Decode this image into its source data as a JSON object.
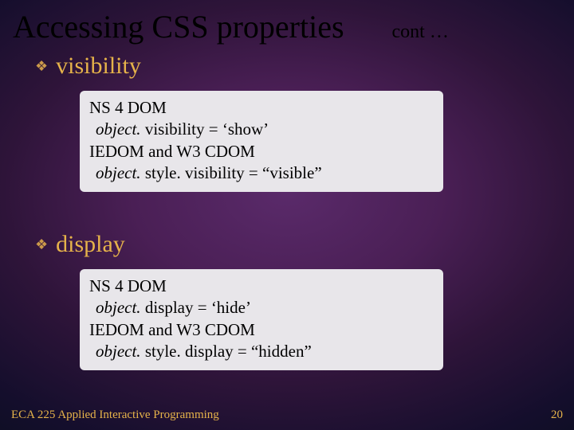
{
  "title": "Accessing CSS properties",
  "cont": "cont …",
  "bullets": [
    {
      "label": "visibility"
    },
    {
      "label": "display"
    }
  ],
  "boxes": [
    {
      "line1": "NS 4 DOM",
      "line2_obj": "object.",
      "line2_rest": " visibility = ‘show’",
      "line3": "IEDOM and W3 CDOM",
      "line4_obj": "object.",
      "line4_rest": " style. visibility = “visible”"
    },
    {
      "line1": "NS 4 DOM",
      "line2_obj": "object.",
      "line2_rest": " display = ‘hide’",
      "line3": "IEDOM and W3 CDOM",
      "line4_obj": "object.",
      "line4_rest": " style. display = “hidden”"
    }
  ],
  "footer": {
    "course": "ECA 225   Applied Interactive Programming",
    "page": "20"
  },
  "colors": {
    "accent": "#e6b34a",
    "diamond": "#cc9a4a",
    "box_bg": "#e8e6ea"
  }
}
